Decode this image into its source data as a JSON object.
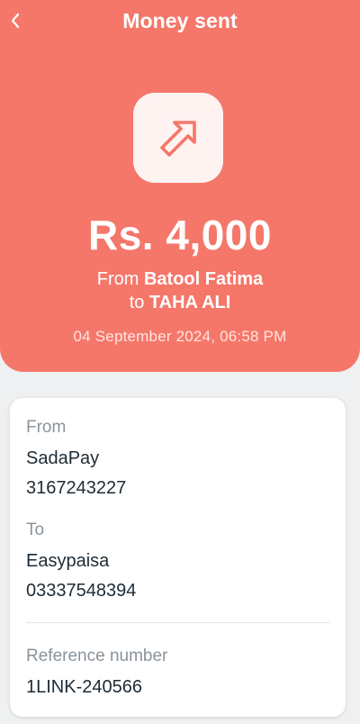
{
  "header": {
    "title": "Money sent",
    "back_icon": "chevron-left-icon"
  },
  "transaction": {
    "icon": "arrow-up-right-icon",
    "amount": "Rs. 4,000",
    "from_prefix": "From",
    "from_name": "Batool Fatima",
    "to_prefix": "to",
    "to_name": "TAHA ALI",
    "datetime": "04 September 2024, 06:58 PM"
  },
  "details": {
    "from_label": "From",
    "from_bank": "SadaPay",
    "from_account": "3167243227",
    "to_label": "To",
    "to_bank": "Easypaisa",
    "to_account": "03337548394",
    "reference_label": "Reference number",
    "reference_value": "1LINK-240566"
  },
  "colors": {
    "accent": "#f5776a",
    "background": "#eef0f1",
    "card": "#ffffff"
  }
}
